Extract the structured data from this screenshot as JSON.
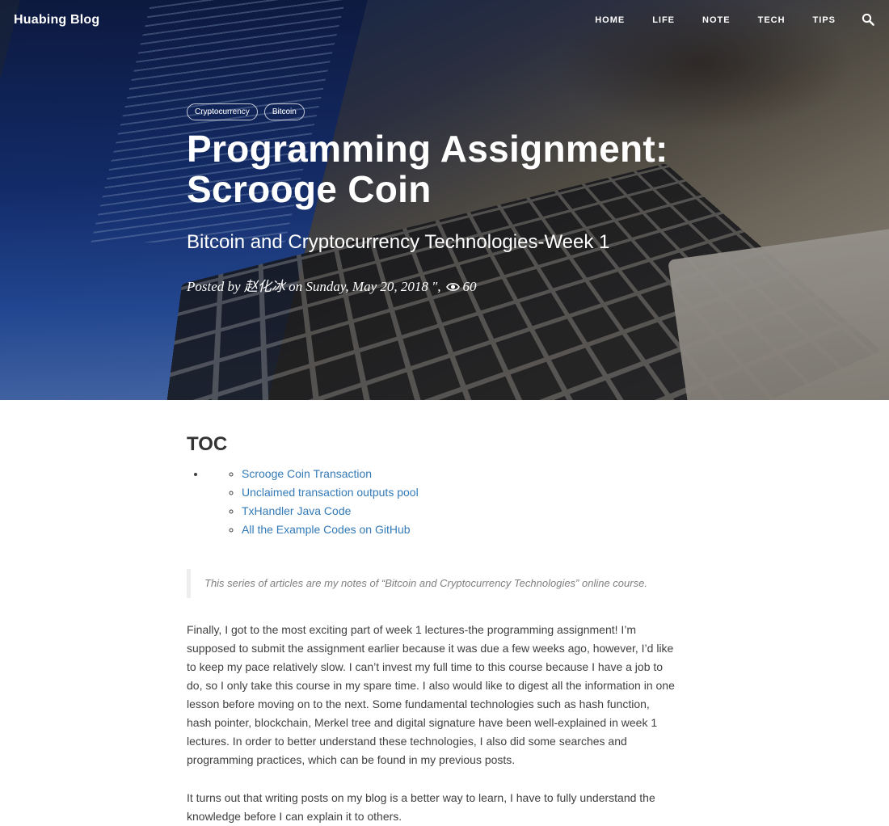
{
  "nav": {
    "brand": "Huabing Blog",
    "items": [
      "HOME",
      "LIFE",
      "NOTE",
      "TECH",
      "TIPS"
    ]
  },
  "post": {
    "tags": [
      "Cryptocurrency",
      "Bitcoin"
    ],
    "title": "Programming Assignment: Scrooge Coin",
    "subtitle": "Bitcoin and Cryptocurrency Technologies-Week 1",
    "meta_prefix": "Posted by ",
    "author": "赵化冰",
    "meta_date": " on Sunday, May 20, 2018 \",",
    "views": "60"
  },
  "toc": {
    "title": "TOC",
    "items": [
      "Scrooge Coin Transaction",
      "Unclaimed transaction outputs pool",
      "TxHandler Java Code",
      "All the Example Codes on GitHub"
    ]
  },
  "quote": "This series of articles are my notes of “Bitcoin and Cryptocurrency Technologies” online course.",
  "paragraphs": [
    "Finally, I got to the most exciting part of week 1 lectures-the programming assignment! I’m supposed to submit the assignment earlier because it was due a few weeks ago, however, I’d like to keep my pace relatively slow. I can’t invest my full time to this course because I have a job to do, so I only take this course in my spare time. I also would like to digest all the information in one lesson before moving on to the next. Some fundamental technologies such as hash function, hash pointer, blockchain, Merkel tree and digital signature have been well-explained in week 1 lectures. In order to better understand these technologies, I also did some searches and programming practices, which can be found in my previous posts.",
    "It turns out that writing posts on my blog is a better way to learn, I have to fully understand the knowledge before I can explain it to others."
  ],
  "colors": {
    "link": "#337ab7",
    "text": "#404040",
    "quote": "#808080"
  }
}
